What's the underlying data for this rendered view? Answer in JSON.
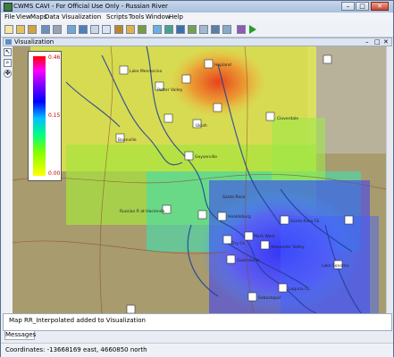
{
  "window": {
    "title": "CWMS CAVI - For Official Use Only - Russian River"
  },
  "menu": [
    "File",
    "View",
    "Maps",
    "Data Visualization",
    "Scripts",
    "Tools",
    "Window",
    "Help"
  ],
  "panel": {
    "title": "Visualization"
  },
  "legend": {
    "max": "0.46",
    "mid": "0.15",
    "min": "0.00"
  },
  "map": {
    "stations": [
      "Lake Mendocino",
      "Potter Valley",
      "Boonville",
      "Hopland",
      "Ukiah",
      "Santa Rosa Ck",
      "Guerneville",
      "Healdsburg",
      "Lake Sonoma",
      "Russian R at Hacienda",
      "Dry Ck",
      "Mark West",
      "Laguna Ck",
      "Santa Rosa",
      "Cloverdale",
      "Geyserville",
      "Alexander Valley",
      "Sebastopol"
    ]
  },
  "messages": {
    "line": "Map RR_Interpolated added to Visualization",
    "tab": "Messages"
  },
  "status": {
    "coordinates": "Coordinates: -13668169 east, 4660850 north"
  },
  "colors": {
    "accent": "#5b8ec4"
  }
}
